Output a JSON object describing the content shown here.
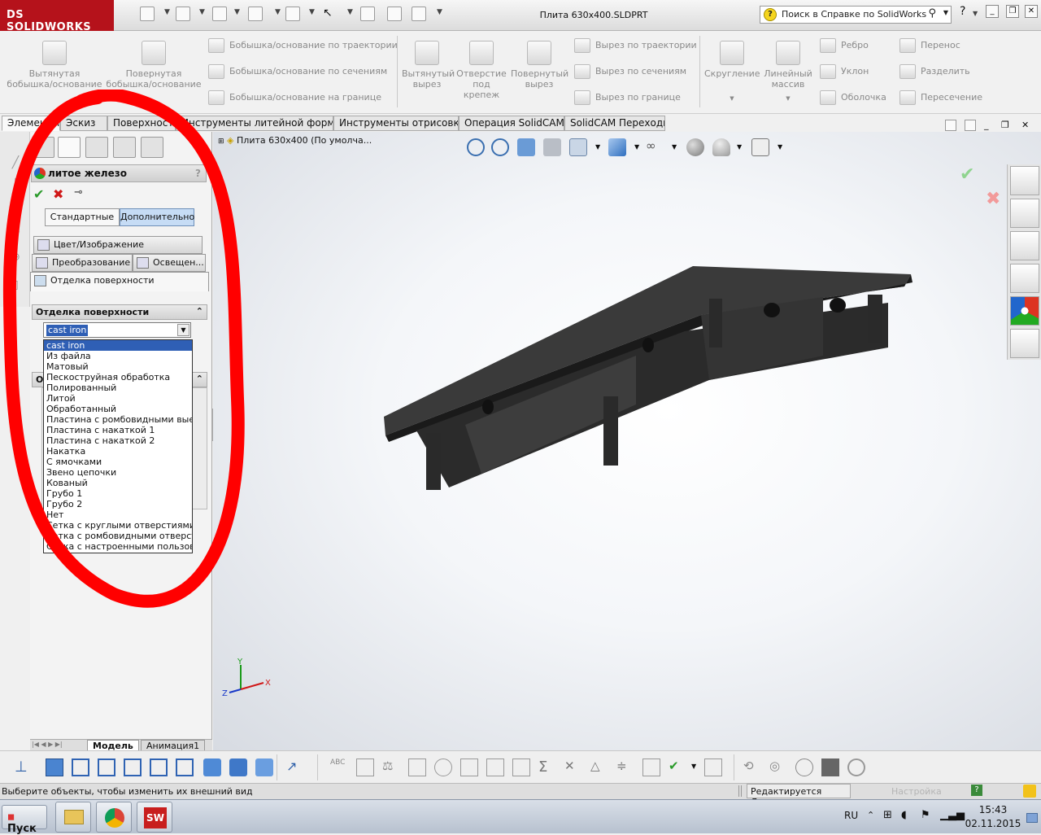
{
  "titlebar": {
    "logo": "SOLIDWORKS",
    "logo_prefix": "DS",
    "document_title": "Плита 630х400.SLDPRT",
    "help_search_placeholder": "Поиск в Справке по SolidWorks",
    "help_menu": "?"
  },
  "commands": {
    "big": [
      {
        "id": "extrude_boss",
        "label": "Вытянутая\nбобышка/основание"
      },
      {
        "id": "revolve_boss",
        "label": "Повернутая\nбобышка/основание"
      },
      {
        "id": "extrude_cut",
        "label": "Вытянутый\nвырез"
      },
      {
        "id": "hole_wizard",
        "label": "Отверстие\nпод\nкрепеж"
      },
      {
        "id": "revolve_cut",
        "label": "Повернутый\nвырез"
      },
      {
        "id": "fillet",
        "label": "Скругление"
      },
      {
        "id": "linear_pattern",
        "label": "Линейный\nмассив"
      }
    ],
    "small": [
      {
        "id": "sweep_boss",
        "label": "Бобышка/основание по траектории"
      },
      {
        "id": "loft_boss",
        "label": "Бобышка/основание по сечениям"
      },
      {
        "id": "boundary_boss",
        "label": "Бобышка/основание на границе"
      },
      {
        "id": "sweep_cut",
        "label": "Вырез по траектории"
      },
      {
        "id": "loft_cut",
        "label": "Вырез по сечениям"
      },
      {
        "id": "boundary_cut",
        "label": "Вырез по границе"
      },
      {
        "id": "rib",
        "label": "Ребро"
      },
      {
        "id": "draft",
        "label": "Уклон"
      },
      {
        "id": "shell",
        "label": "Оболочка"
      },
      {
        "id": "move",
        "label": "Перенос"
      },
      {
        "id": "split",
        "label": "Разделить"
      },
      {
        "id": "intersect",
        "label": "Пересечение"
      }
    ]
  },
  "tabs": [
    "Элементы",
    "Эскиз",
    "Поверхности",
    "Инструменты литейной формы",
    "Инструменты отрисовки",
    "Операция  SolidCAM",
    "SolidCAM Переходы"
  ],
  "property_manager": {
    "title": "литое железо",
    "help": "?",
    "mode_buttons": [
      "Стандартные",
      "Дополнительно"
    ],
    "subtabs": {
      "color_image": "Цвет/Изображение",
      "transform": "Преобразование",
      "lighting": "Освещен...",
      "surface_finish": "Отделка поверхности"
    },
    "group_title": "Отделка поверхности",
    "second_group_title": "От",
    "combo_value": "cast iron",
    "options": [
      "cast iron",
      "Из файла",
      "Матовый",
      "Пескоструйная обработка",
      "Полированный",
      "Литой",
      "Обработанный",
      "Пластина с ромбовидными выемками",
      "Пластина с накаткой 1",
      "Пластина с накаткой 2",
      "Накатка",
      "С ямочками",
      "Звено цепочки",
      "Кованый",
      "Грубо 1",
      "Грубо 2",
      "Нет",
      "Сетка с круглыми отверстиями",
      "Сетка с ромбовидными отверстиями",
      "Сетка с настроенными пользователем"
    ],
    "selected_option": "cast iron",
    "bottom_tabs": [
      "Модель",
      "Анимация1"
    ]
  },
  "viewport": {
    "tree_label": "Плита 630х400  (По умолча...",
    "triad": {
      "x": "X",
      "y": "Y",
      "z": "Z"
    }
  },
  "statusbar": {
    "message": "Выберите объекты, чтобы изменить их внешний вид",
    "mode": "Редактируется Деталь",
    "settings": "Настройка",
    "help": "?"
  },
  "taskbar": {
    "start": "Пуск",
    "lang": "RU",
    "time": "15:43",
    "date": "02.11.2015"
  },
  "colors": {
    "brand": "#b5121b",
    "selection": "#2f5fb5",
    "annotation_circle": "#ff0000"
  }
}
